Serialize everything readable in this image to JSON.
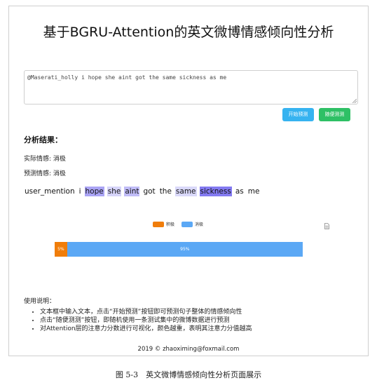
{
  "page": {
    "title": "基于BGRU-Attention的英文微博情感倾向性分析"
  },
  "input": {
    "value": "@Maserati_holly i hope she aint got the same sickness as me"
  },
  "buttons": {
    "predict": "开始预测",
    "random": "随便测测"
  },
  "results": {
    "heading": "分析结果：",
    "actual_label": "实际情感:",
    "actual_value": "消极",
    "predicted_label": "预测情感:",
    "predicted_value": "消极",
    "tokens": [
      {
        "text": "user_mention",
        "weight": 0.0
      },
      {
        "text": "i",
        "weight": 0.0
      },
      {
        "text": "hope",
        "weight": 0.55
      },
      {
        "text": "she",
        "weight": 0.15
      },
      {
        "text": "aint",
        "weight": 0.35
      },
      {
        "text": "got",
        "weight": 0.0
      },
      {
        "text": "the",
        "weight": 0.0
      },
      {
        "text": "same",
        "weight": 0.12
      },
      {
        "text": "sickness",
        "weight": 0.9
      },
      {
        "text": "as",
        "weight": 0.0
      },
      {
        "text": "me",
        "weight": 0.0
      }
    ]
  },
  "chart_data": {
    "type": "bar",
    "orientation": "horizontal-stacked",
    "legend_position": "top",
    "series": [
      {
        "name": "积极",
        "value": 5,
        "label": "5%",
        "color": "#f07d0a"
      },
      {
        "name": "消极",
        "value": 95,
        "label": "95%",
        "color": "#5ba8f5"
      }
    ]
  },
  "instructions": {
    "title": "使用说明：",
    "items": [
      "文本框中输入文本，点击“开始预测”按钮即可预测句子整体的情感倾向性",
      "点击“随便测测”按钮，即随机使用一条测试集中的微博数据进行预测",
      "对Attention层的注意力分数进行可视化，颜色越重，表明其注意力分值越高"
    ]
  },
  "footer": {
    "text": "2019 © zhaoximing@foxmail.com"
  },
  "caption": {
    "text": "图 5-3　英文微博情感倾向性分析页面展示"
  }
}
